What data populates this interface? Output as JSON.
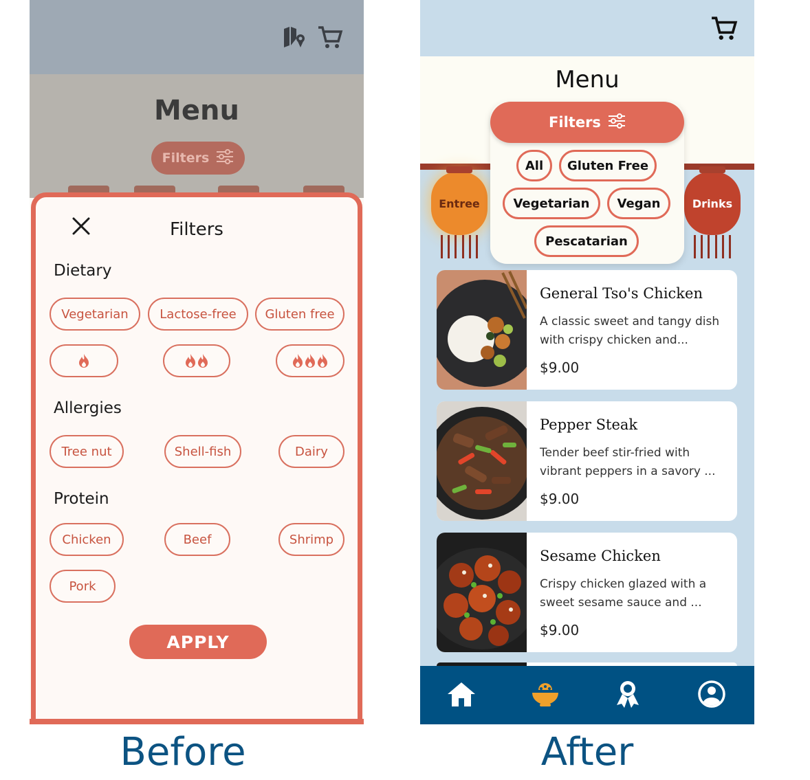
{
  "before": {
    "caption": "Before",
    "header": {
      "menu_title": "Menu",
      "filters_label": "Filters",
      "icons": [
        "map-pin-icon",
        "cart-icon"
      ]
    },
    "sheet": {
      "title": "Filters",
      "close_icon": "close-icon",
      "sections": {
        "dietary": {
          "heading": "Dietary",
          "chips": [
            "Vegetarian",
            "Lactose-free",
            "Gluten free"
          ],
          "spice_levels": [
            1,
            2,
            3
          ]
        },
        "allergies": {
          "heading": "Allergies",
          "chips": [
            "Tree nut",
            "Shell-fish",
            "Dairy"
          ]
        },
        "protein": {
          "heading": "Protein",
          "chips": [
            "Chicken",
            "Beef",
            "Shrimp",
            "Pork"
          ]
        }
      },
      "apply_label": "APPLY"
    },
    "colors": {
      "accent": "#e06a58",
      "chip_text": "#c7533f",
      "sheet_bg": "#fef9f6"
    }
  },
  "after": {
    "caption": "After",
    "header": {
      "cart_icon": "cart-icon",
      "menu_title": "Menu"
    },
    "filters": {
      "label": "Filters",
      "icon": "sliders-icon",
      "chips": [
        "All",
        "Gluten Free",
        "Vegetarian",
        "Vegan",
        "Pescatarian"
      ]
    },
    "lanterns": {
      "left": "Entree",
      "right": "Drinks"
    },
    "menu_items": [
      {
        "name": "General Tso's Chicken",
        "description": "A classic sweet and tangy dish with crispy chicken and...",
        "price": "$9.00"
      },
      {
        "name": "Pepper Steak",
        "description": "Tender beef stir-fried with vibrant peppers in a savory ...",
        "price": "$9.00"
      },
      {
        "name": "Sesame Chicken",
        "description": "Crispy chicken glazed with a sweet sesame sauce and ...",
        "price": "$9.00"
      }
    ],
    "nav": [
      "home-icon",
      "food-bowl-icon",
      "rewards-icon",
      "profile-icon"
    ],
    "colors": {
      "accent": "#e06a58",
      "background": "#c8dcea",
      "nav_bg": "#005183",
      "nav_active": "#f0a02b"
    }
  }
}
